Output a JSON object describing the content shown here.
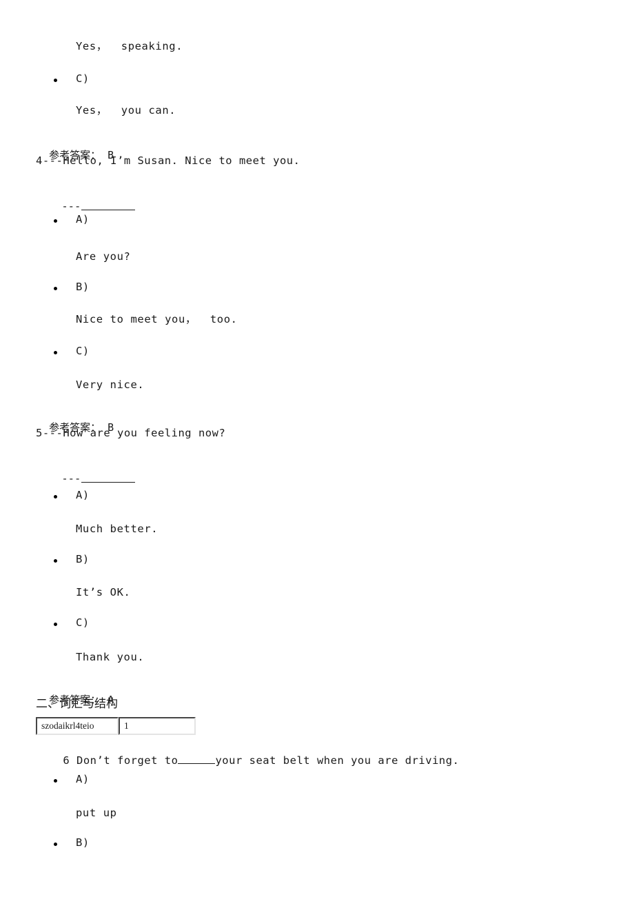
{
  "document": {
    "type": "exam-paper",
    "language": "zh-CN + en",
    "answer_label": "参考答案："
  },
  "blocks": {
    "q3_tail": {
      "option_b_text": "Yes，  speaking.",
      "option_c_label": "C)",
      "option_c_text": "Yes，  you can.",
      "answer_label": "参考答案：",
      "answer_value": "B"
    },
    "q4": {
      "stem": "4---Hello, I’m Susan. Nice to meet you.",
      "reply_dashes": "---",
      "options": [
        {
          "label": "A)",
          "text": "Are you?"
        },
        {
          "label": "B)",
          "text": "Nice to meet you，  too."
        },
        {
          "label": "C)",
          "text": "Very nice."
        }
      ],
      "answer_label": "参考答案：",
      "answer_value": "B"
    },
    "q5": {
      "stem": "5---How are you feeling now?",
      "reply_dashes": "---",
      "options": [
        {
          "label": "A)",
          "text": "Much better."
        },
        {
          "label": "B)",
          "text": "It’s OK."
        },
        {
          "label": "C)",
          "text": "Thank you."
        }
      ],
      "answer_label": "参考答案：",
      "answer_value": "A"
    },
    "section2": {
      "heading": "二、词汇与结构",
      "inputs": [
        {
          "name": "code-field",
          "value": "szodaikrl4teio",
          "placeholder": ""
        },
        {
          "name": "number-field",
          "value": "1",
          "placeholder": ""
        }
      ]
    },
    "q6": {
      "stem_before": "6 Don’t forget to",
      "stem_after": "your seat belt when you are driving.",
      "options": [
        {
          "label": "A)",
          "text": "put up"
        },
        {
          "label": "B)",
          "text": ""
        }
      ]
    }
  }
}
